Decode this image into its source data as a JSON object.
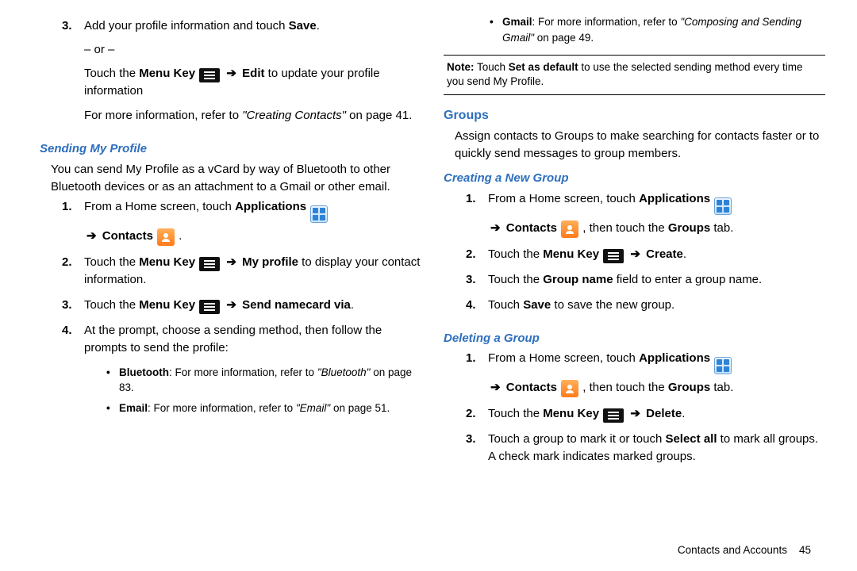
{
  "left": {
    "top_list": [
      {
        "pre": "Add your profile information and touch ",
        "bold": "Save",
        "post": "."
      }
    ],
    "or_line": "– or –",
    "touch_menu_edit_pre": "Touch the ",
    "menukey_label": "Menu Key",
    "touch_menu_edit_post": " to update your profile information",
    "edit_word": "Edit",
    "more_info_pre": "For more information, refer to ",
    "more_info_ref": "\"Creating Contacts\"",
    "more_info_post": " on page 41.",
    "h_sending": "Sending My Profile",
    "sending_para": "You can send My Profile as a vCard by way of Bluetooth to other Bluetooth devices or as an attachment to a Gmail or other email.",
    "list2": {
      "i1_pre": "From a Home screen, touch ",
      "apps_label": "Applications",
      "contacts_label": "Contacts",
      "i2_pre": "Touch the ",
      "i2_action": "My profile",
      "i2_post": " to display your contact information.",
      "i3_action": "Send namecard via",
      "i4": "At the prompt, choose a sending method, then follow the prompts to send the profile:"
    },
    "bullets": [
      {
        "label": "Bluetooth",
        "mid": ": For more information, refer to ",
        "ref": "\"Bluetooth\"",
        "tail": " on page 83."
      },
      {
        "label": "Email",
        "mid": ": For more information, refer to ",
        "ref": "\"Email\"",
        "tail": " on page 51."
      }
    ]
  },
  "right": {
    "top_bullet": {
      "label": "Gmail",
      "mid": ": For more information, refer to ",
      "ref": "\"Composing and Sending Gmail\"",
      "tail": " on page 49."
    },
    "note_label": "Note:",
    "note_pre": " Touch ",
    "note_bold": "Set as default",
    "note_post": " to use the selected sending method every time you send My Profile.",
    "h_groups": "Groups",
    "groups_para": "Assign contacts to Groups to make searching for contacts faster or to quickly send messages to group members.",
    "h_create": "Creating a New Group",
    "create": {
      "i1_pre": "From a Home screen, touch ",
      "groups_tab_pre": ", then touch the ",
      "groups_tab": "Groups",
      "groups_tab_post": " tab.",
      "i2_action": "Create",
      "i3_pre": "Touch the ",
      "i3_bold": "Group name",
      "i3_post": " field to enter a group name.",
      "i4_pre": "Touch ",
      "i4_bold": "Save",
      "i4_post": " to save the new group."
    },
    "h_delete": "Deleting a Group",
    "del": {
      "i2_action": "Delete",
      "i3_pre": "Touch a group to mark it or touch ",
      "i3_bold": "Select all",
      "i3_post": " to mark all groups. A check mark indicates marked groups."
    }
  },
  "footer": {
    "section": "Contacts and Accounts",
    "page": "45"
  },
  "period": "."
}
